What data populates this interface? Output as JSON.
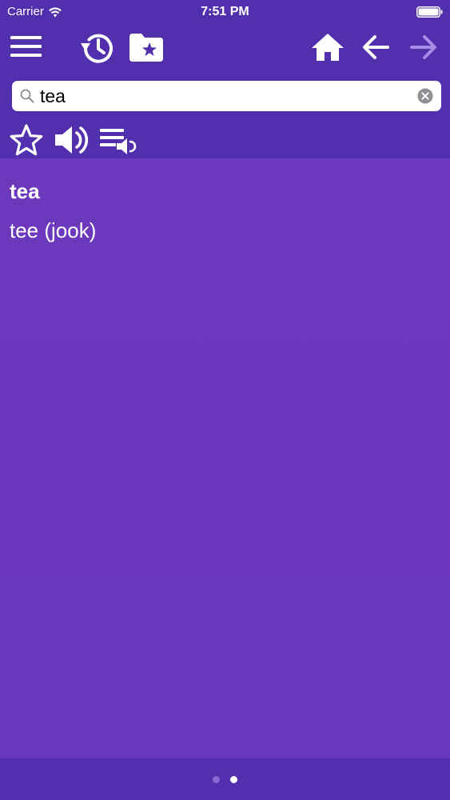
{
  "status_bar": {
    "carrier": "Carrier",
    "time": "7:51 PM"
  },
  "nav": {
    "icons": [
      "menu-icon",
      "history-icon",
      "favorites-folder-icon",
      "home-icon",
      "back-arrow-icon",
      "forward-arrow-icon"
    ],
    "forward_enabled": false
  },
  "search": {
    "value": "tea",
    "placeholder": ""
  },
  "toolbar": {
    "icons": [
      "star-icon",
      "speaker-icon",
      "playlist-audio-icon"
    ]
  },
  "entry": {
    "headword": "tea",
    "translation": "tee (jook)"
  },
  "pager": {
    "page_count": 2,
    "current_page": 2
  },
  "colors": {
    "bar_background": "#5230ad",
    "content_background": "#6b37bb",
    "text": "#ffffff",
    "disabled_icon": "#a78ce6"
  }
}
